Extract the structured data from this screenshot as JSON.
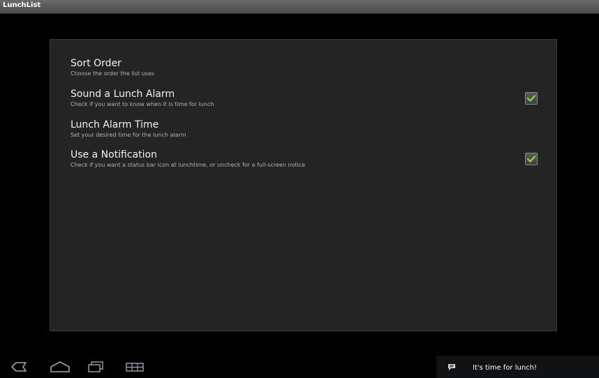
{
  "window": {
    "title": "LunchList"
  },
  "preferences": [
    {
      "title": "Sort Order",
      "summary": "Choose the order the list uses"
    },
    {
      "title": "Sound a Lunch Alarm",
      "summary": "Check if you want to know when it is time for lunch",
      "checked": true
    },
    {
      "title": "Lunch Alarm Time",
      "summary": "Set your desired time for the lunch alarm"
    },
    {
      "title": "Use a Notification",
      "summary": "Check if you want a status bar icon at lunchtime, or uncheck for a full-screen notice",
      "checked": true
    }
  ],
  "navbar": {
    "buttons": [
      "back-icon",
      "home-icon",
      "recent-apps-icon",
      "menu-icon"
    ]
  },
  "notification": {
    "text": "It's time for lunch!",
    "icon": "chat-bubble-icon"
  },
  "colors": {
    "check": "#8ad42e",
    "panel": "#242424",
    "background": "#000000"
  }
}
